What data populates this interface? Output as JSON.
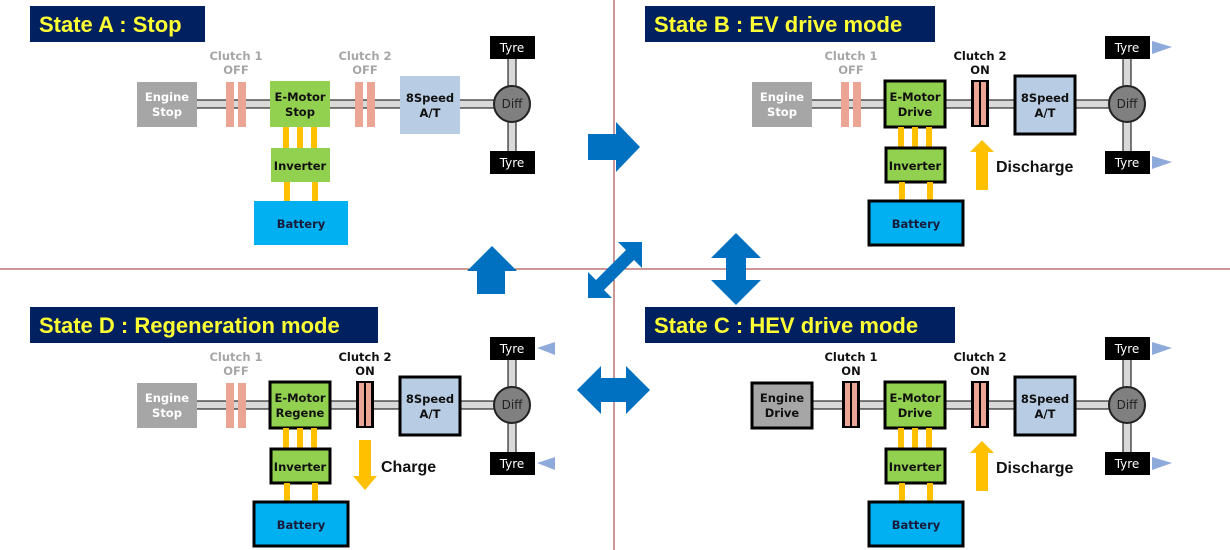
{
  "colors": {
    "title_bg": "#002060",
    "title_fg": "#ffff33",
    "engine_off": "#a6a6a6",
    "engine_on": "#a6a6a6",
    "motor": "#92d050",
    "inverter": "#92d050",
    "battery": "#00b0f0",
    "at": "#b8cce4",
    "clutch": "#eba594",
    "shaft": "#d9d9d9",
    "cable": "#ffc000",
    "diff": "#808080",
    "tyre": "#000000",
    "tyre_arrow": "#8eaadb",
    "transition_arrow": "#0070c0",
    "divider": "#9b2f2f",
    "inactive_text": "#a6a6a6",
    "active_text": "#111111"
  },
  "states": [
    {
      "id": "A",
      "title": "State A : Stop",
      "engine": {
        "line1": "Engine",
        "line2": "Stop",
        "active": false
      },
      "clutch1": {
        "name": "Clutch 1",
        "state": "OFF",
        "engaged": false
      },
      "motor": {
        "line1": "E-Motor",
        "line2": "Stop",
        "active": false
      },
      "clutch2": {
        "name": "Clutch 2",
        "state": "OFF",
        "engaged": false
      },
      "at": {
        "line1": "8Speed",
        "line2": "A/T",
        "active": false
      },
      "inverter": {
        "label": "Inverter",
        "active": false
      },
      "battery": {
        "label": "Battery",
        "active": false
      },
      "diff": {
        "label": "Diff"
      },
      "tyre_top": {
        "label": "Tyre"
      },
      "tyre_bottom": {
        "label": "Tyre"
      },
      "tyre_arrows": "none",
      "flow": {
        "label": "",
        "direction": "none"
      }
    },
    {
      "id": "B",
      "title": "State B : EV drive mode",
      "engine": {
        "line1": "Engine",
        "line2": "Stop",
        "active": false
      },
      "clutch1": {
        "name": "Clutch 1",
        "state": "OFF",
        "engaged": false
      },
      "motor": {
        "line1": "E-Motor",
        "line2": "Drive",
        "active": true
      },
      "clutch2": {
        "name": "Clutch 2",
        "state": "ON",
        "engaged": true
      },
      "at": {
        "line1": "8Speed",
        "line2": "A/T",
        "active": true
      },
      "inverter": {
        "label": "Inverter",
        "active": true
      },
      "battery": {
        "label": "Battery",
        "active": true
      },
      "diff": {
        "label": "Diff"
      },
      "tyre_top": {
        "label": "Tyre"
      },
      "tyre_bottom": {
        "label": "Tyre"
      },
      "tyre_arrows": "right",
      "flow": {
        "label": "Discharge",
        "direction": "up"
      }
    },
    {
      "id": "D",
      "title": "State D : Regeneration mode",
      "engine": {
        "line1": "Engine",
        "line2": "Stop",
        "active": false
      },
      "clutch1": {
        "name": "Clutch 1",
        "state": "OFF",
        "engaged": false
      },
      "motor": {
        "line1": "E-Motor",
        "line2": "Regene",
        "active": true
      },
      "clutch2": {
        "name": "Clutch 2",
        "state": "ON",
        "engaged": true
      },
      "at": {
        "line1": "8Speed",
        "line2": "A/T",
        "active": true
      },
      "inverter": {
        "label": "Inverter",
        "active": true
      },
      "battery": {
        "label": "Battery",
        "active": true
      },
      "diff": {
        "label": "Diff"
      },
      "tyre_top": {
        "label": "Tyre"
      },
      "tyre_bottom": {
        "label": "Tyre"
      },
      "tyre_arrows": "left",
      "flow": {
        "label": "Charge",
        "direction": "down"
      }
    },
    {
      "id": "C",
      "title": "State C : HEV drive mode",
      "engine": {
        "line1": "Engine",
        "line2": "Drive",
        "active": true
      },
      "clutch1": {
        "name": "Clutch 1",
        "state": "ON",
        "engaged": true
      },
      "motor": {
        "line1": "E-Motor",
        "line2": "Drive",
        "active": true
      },
      "clutch2": {
        "name": "Clutch 2",
        "state": "ON",
        "engaged": true
      },
      "at": {
        "line1": "8Speed",
        "line2": "A/T",
        "active": true
      },
      "inverter": {
        "label": "Inverter",
        "active": true
      },
      "battery": {
        "label": "Battery",
        "active": true
      },
      "diff": {
        "label": "Diff"
      },
      "tyre_top": {
        "label": "Tyre"
      },
      "tyre_bottom": {
        "label": "Tyre"
      },
      "tyre_arrows": "right",
      "flow": {
        "label": "Discharge",
        "direction": "up"
      }
    }
  ],
  "transitions": [
    {
      "name": "transition-a-to-b",
      "from": "A",
      "to": "B",
      "shape": "right"
    },
    {
      "name": "transition-d-to-a",
      "from": "D",
      "to": "A",
      "shape": "up"
    },
    {
      "name": "transition-b-c",
      "from": "B",
      "to": "C",
      "shape": "up-down"
    },
    {
      "name": "transition-d-c",
      "from": "D",
      "to": "C",
      "shape": "left-right"
    },
    {
      "name": "transition-b-d",
      "from": "B",
      "to": "D",
      "shape": "diagonal"
    }
  ]
}
